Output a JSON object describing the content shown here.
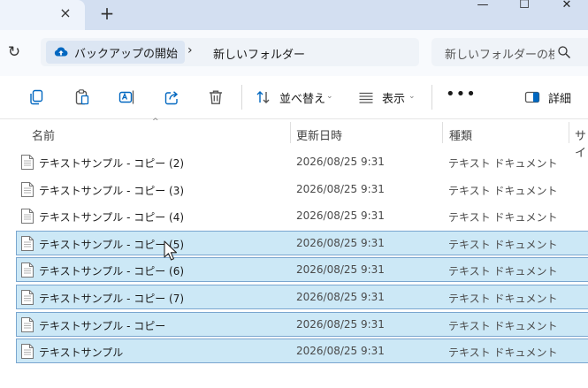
{
  "titlebar": {
    "close_tab_glyph": "×",
    "new_tab_glyph": "+",
    "minimize_glyph": "—",
    "maximize_glyph": "☐",
    "close_window_glyph": "✕"
  },
  "navbar": {
    "refresh_glyph": "↻",
    "breadcrumb": [
      "バックアップの開始",
      "新しいフォルダー"
    ],
    "separator": "›",
    "search_placeholder": "新しいフォルダーの検索"
  },
  "toolbar": {
    "sort_label": "並べ替え",
    "view_label": "表示",
    "more_glyph": "•••",
    "details_label": "詳細",
    "chevron": "⌄"
  },
  "columns": {
    "name": "名前",
    "date": "更新日時",
    "type": "種類",
    "size": "サイ",
    "sort_caret": "^"
  },
  "files": [
    {
      "name": "テキストサンプル - コピー (2)",
      "date": "2026/08/25 9:31",
      "type": "テキスト ドキュメント",
      "selected": false
    },
    {
      "name": "テキストサンプル - コピー (3)",
      "date": "2026/08/25 9:31",
      "type": "テキスト ドキュメント",
      "selected": false
    },
    {
      "name": "テキストサンプル - コピー (4)",
      "date": "2026/08/25 9:31",
      "type": "テキスト ドキュメント",
      "selected": false
    },
    {
      "name": "テキストサンプル - コピー (5)",
      "date": "2026/08/25 9:31",
      "type": "テキスト ドキュメント",
      "selected": true
    },
    {
      "name": "テキストサンプル - コピー (6)",
      "date": "2026/08/25 9:31",
      "type": "テキスト ドキュメント",
      "selected": true
    },
    {
      "name": "テキストサンプル - コピー (7)",
      "date": "2026/08/25 9:31",
      "type": "テキスト ドキュメント",
      "selected": true
    },
    {
      "name": "テキストサンプル - コピー",
      "date": "2026/08/25 9:31",
      "type": "テキスト ドキュメント",
      "selected": true
    },
    {
      "name": "テキストサンプル",
      "date": "2026/08/25 9:31",
      "type": "テキスト ドキュメント",
      "selected": true
    }
  ],
  "colors": {
    "accent": "#0067c0",
    "selection_bg": "#cce8f6",
    "selection_border": "#7aa6cf",
    "titlebar_bg": "#d3dff1"
  }
}
